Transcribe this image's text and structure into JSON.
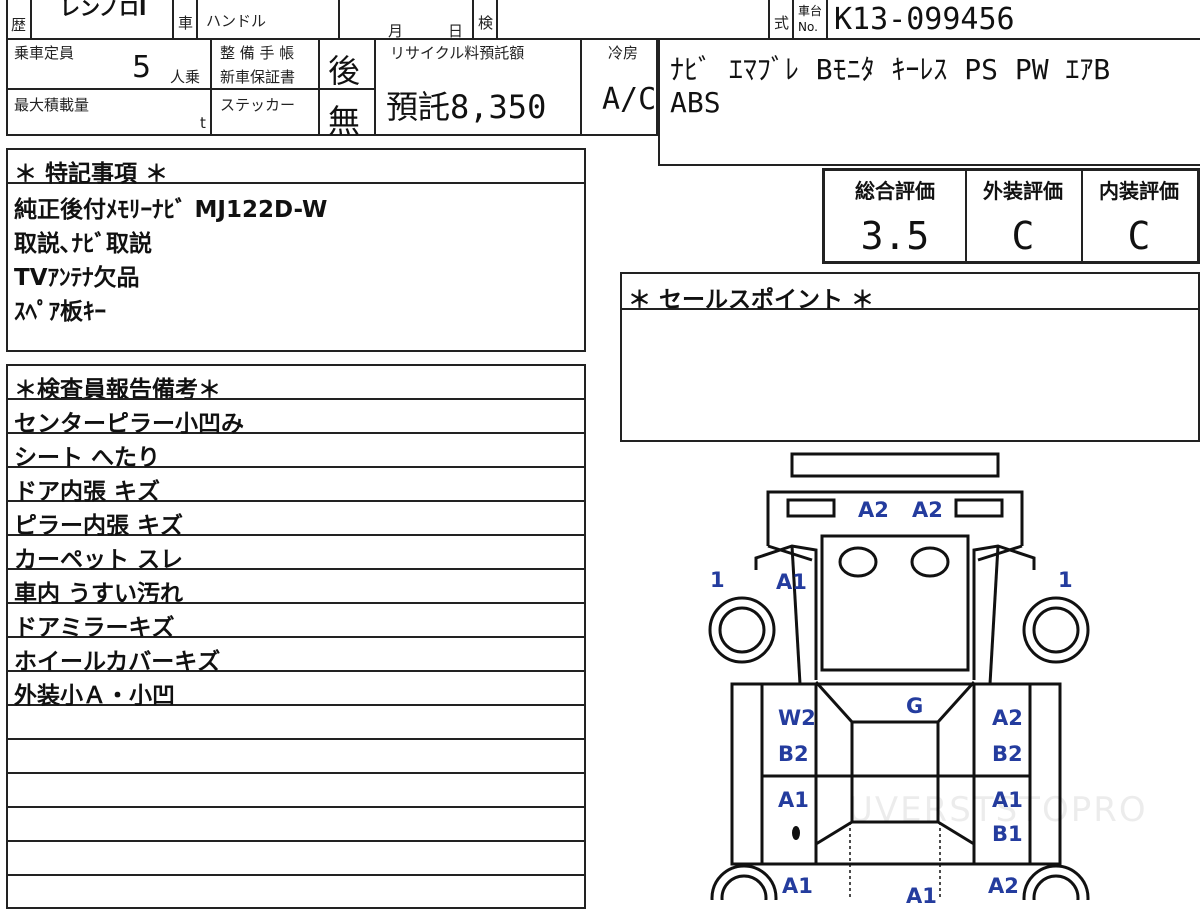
{
  "header": {
    "history_label": "歴",
    "model_partial": "レンノロI",
    "car_label": "車",
    "handle_label": "ハンドル",
    "month_label": "月",
    "day_label": "日",
    "inspection_label": "検",
    "type_label": "式",
    "chassis_label_top": "車台",
    "chassis_label_bottom": "No.",
    "chassis_no": "K13-099456"
  },
  "specs": {
    "capacity_label": "乗車定員",
    "capacity_value": "5",
    "capacity_unit": "人乗",
    "maintenance_label_1": "整 備 手 帳",
    "maintenance_label_2": "新車保証書",
    "maintenance_value": "後",
    "max_load_label": "最大積載量",
    "max_load_unit": "t",
    "sticker_label": "ステッカー",
    "sticker_value": "無",
    "recycle_label": "リサイクル料預託額",
    "recycle_value": "預託8,350",
    "aircon_label": "冷房",
    "aircon_value": "A/C",
    "equipment_line1": "ﾅﾋﾞ ｴﾏﾌﾞﾚ Bﾓﾆﾀ ｷｰﾚｽ PS PW ｴｱB",
    "equipment_line2": "ABS"
  },
  "special_notes": {
    "title": "＊ 特記事項 ＊",
    "lines": [
      "純正後付ﾒﾓﾘｰﾅﾋﾞ MJ122D-W",
      "取説､ﾅﾋﾞ取説",
      "TVｱﾝﾃﾅ欠品",
      "ｽﾍﾟｱ板ｷｰ"
    ]
  },
  "grades": {
    "overall_label": "総合評価",
    "overall_value": "3.5",
    "exterior_label": "外装評価",
    "exterior_value": "C",
    "interior_label": "内装評価",
    "interior_value": "C"
  },
  "sales_point": {
    "title": "＊ セールスポイント ＊"
  },
  "inspector_report": {
    "title": "＊検査員報告備考＊",
    "lines": [
      "センターピラー小凹み",
      "シート へたり",
      "ドア内張 キズ",
      "ピラー内張 キズ",
      "カーペット スレ",
      "車内 うすい汚れ",
      "ドアミラーキズ",
      "ホイールカバーキズ",
      "外装小Ａ・小凹",
      "",
      "",
      "",
      "",
      "",
      "",
      ""
    ]
  },
  "diagram_marks": {
    "front_a2_left": "A2",
    "front_a2_right": "A2",
    "wheel_fl": "1",
    "wheel_fr": "1",
    "fender_fl": "A1",
    "glass_front": "G",
    "door_fl_1": "W2",
    "door_fl_2": "B2",
    "door_fr_1": "A2",
    "door_fr_2": "B2",
    "door_rl_1": "A1",
    "door_rr_1": "A1",
    "door_rr_2": "B1",
    "rear_fl": "A1",
    "rear_center": "A1",
    "rear_fr": "A2"
  },
  "watermark": "UVERSTSTOPRO"
}
